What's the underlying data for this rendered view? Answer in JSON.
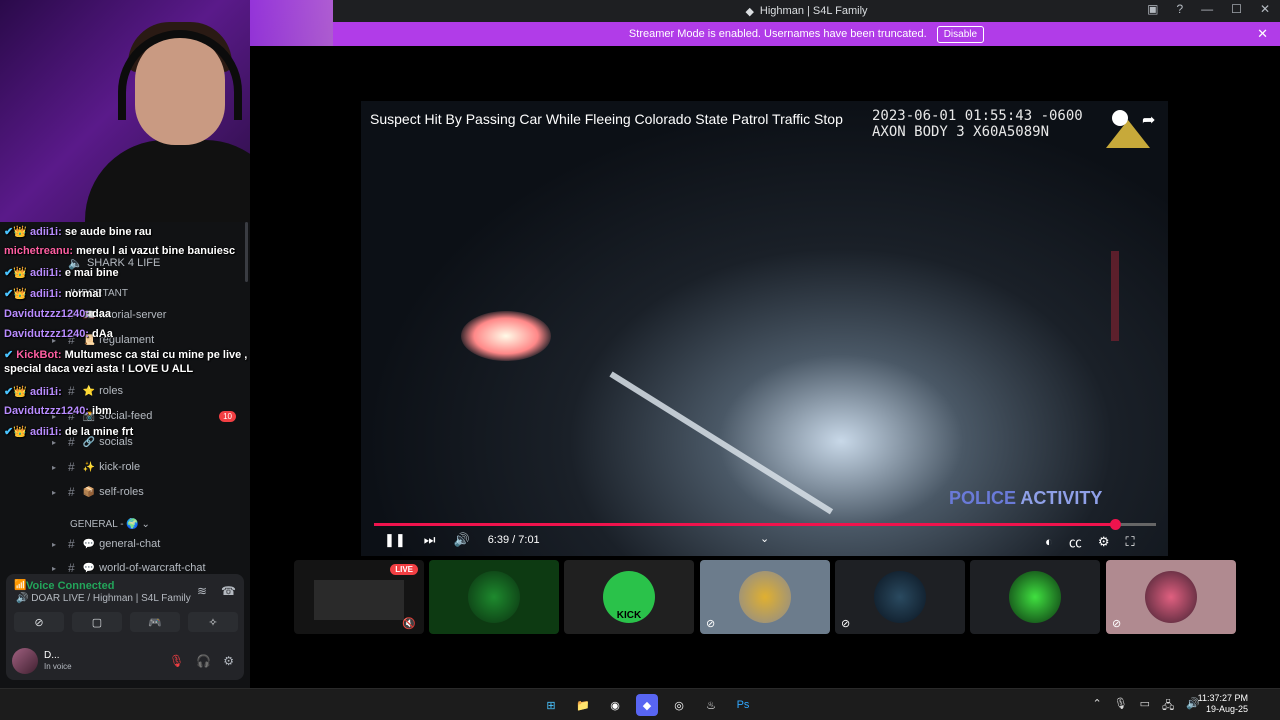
{
  "window": {
    "title": "Highman | S4L Family"
  },
  "streamer_bar": {
    "message": "Streamer Mode is enabled. Usernames have been truncated.",
    "disable_label": "Disable",
    "close_icon": "close-icon"
  },
  "sidebar": {
    "server_label": "SHARK 4 LIFE",
    "channels": [
      {
        "name": "tutorial-server",
        "emoji": "📖"
      },
      {
        "name": "regulament",
        "emoji": "📜"
      },
      {
        "name": "roles",
        "emoji": "⭐"
      },
      {
        "name": "social-feed",
        "emoji": "📸",
        "badge": "10"
      },
      {
        "name": "socials",
        "emoji": "🔗"
      },
      {
        "name": "kick-role",
        "emoji": "✨"
      },
      {
        "name": "self-roles",
        "emoji": "📦"
      },
      {
        "name": "general-chat",
        "emoji": "💬"
      },
      {
        "name": "world-of-warcraft-chat",
        "emoji": "💬"
      }
    ],
    "category_general": "GENERAL -",
    "category_important": "IMPORTANT"
  },
  "chat": [
    {
      "user": "adii1i:",
      "text": "se aude bine rau"
    },
    {
      "user": "michetreanu:",
      "text": "mereu l ai vazut bine banuiesc"
    },
    {
      "user": "adii1i:",
      "text": "e mai bine"
    },
    {
      "user": "adii1i:",
      "text": "normal"
    },
    {
      "user": "Davidutzzz1240:",
      "text": "daa"
    },
    {
      "user": "Davidutzzz1240:",
      "text": "dAa"
    },
    {
      "user": "KickBot:",
      "text": "Multumesc ca stai cu mine pe live , esti"
    },
    {
      "user": "",
      "text": "special daca vezi asta ! LOVE U ALL"
    },
    {
      "user": "adii1i:",
      "text": ""
    },
    {
      "user": "Davidutzzz1240:",
      "text": "ibm"
    },
    {
      "user": "adii1i:",
      "text": "de la mine frt"
    }
  ],
  "voice": {
    "status": "Voice Connected",
    "location": "DOAR LIVE / Highman | S4L Family",
    "user_name": "D...",
    "user_status": "In voice"
  },
  "video": {
    "title": "Suspect Hit By Passing Car While Fleeing Colorado State Patrol Traffic Stop",
    "stamp_line1": "2023-06-01 01:55:43 -0600",
    "stamp_line2": "AXON BODY 3 X60A5089N",
    "watermark_a": "POLICE",
    "watermark_b": "ACTIVITY",
    "time": "6:39 / 7:01",
    "progress": 0.95
  },
  "tiles": {
    "live_label": "LIVE",
    "kick_label": "KICK"
  },
  "taskbar": {
    "time": "11:37:27 PM",
    "date": "19-Aug-25"
  },
  "colors": {
    "accent": "#b13ce8",
    "progress": "#f0134d",
    "voice_green": "#23a55a"
  }
}
